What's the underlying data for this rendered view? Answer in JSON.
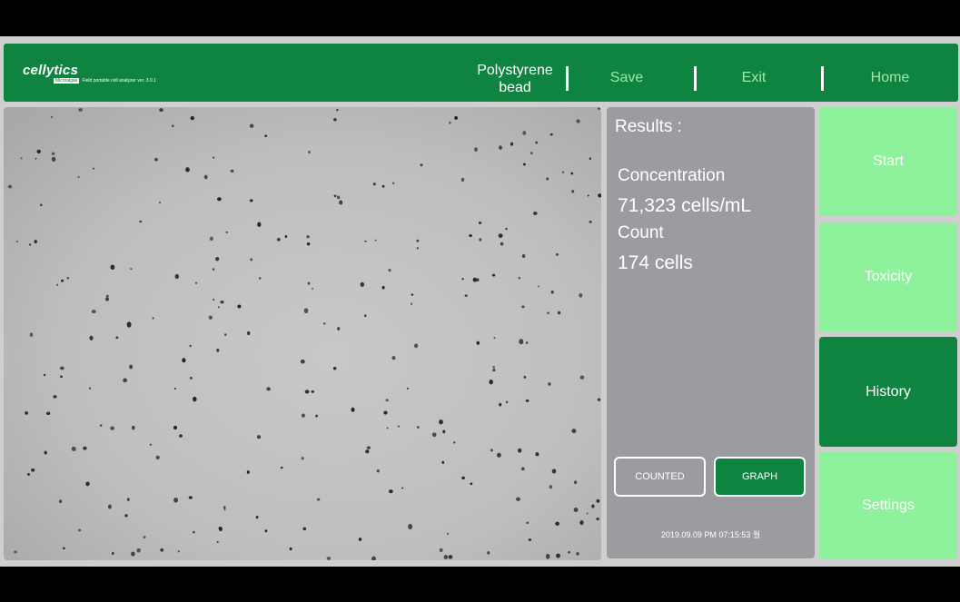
{
  "header": {
    "logo_text": "cellytics",
    "logo_badge": "Microalgae",
    "logo_subtitle": "Field portable cell analyzer ver. 3.0.1",
    "sample_title": "Polystyrene bead",
    "nav": [
      {
        "label": "Save"
      },
      {
        "label": "Exit"
      },
      {
        "label": "Home"
      }
    ]
  },
  "results": {
    "title": "Results :",
    "concentration_label": "Concentration",
    "concentration_value": "71,323 cells/mL",
    "count_label": "Count",
    "count_value": "174 cells",
    "counted_button": "COUNTED",
    "graph_button": "GRAPH",
    "timestamp": "2019.09.09 PM 07:15:53 월"
  },
  "sidebar": {
    "items": [
      {
        "label": "Start",
        "active": false
      },
      {
        "label": "Toxicity",
        "active": false
      },
      {
        "label": "History",
        "active": true
      },
      {
        "label": "Settings",
        "active": false
      }
    ]
  },
  "colors": {
    "header_green": "#0e8440",
    "light_green": "#8df29b",
    "dark_green": "#0e8440",
    "nav_text": "#9fe8a8",
    "results_bg": "#9b9ca0"
  }
}
